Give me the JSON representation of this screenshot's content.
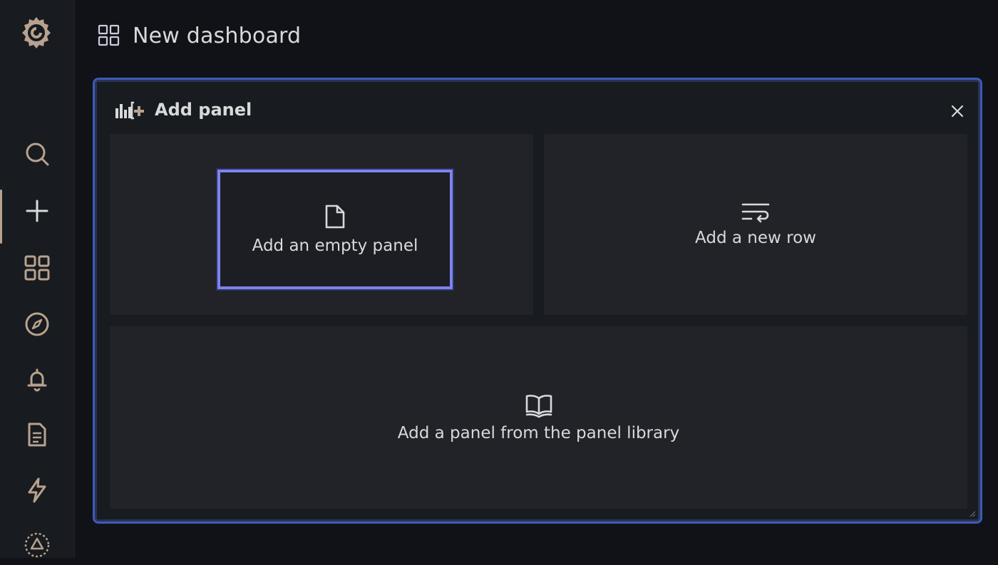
{
  "header": {
    "title": "New dashboard",
    "icon": "dashboard-grid-icon"
  },
  "sidebar": {
    "logo": "grafana-logo",
    "items": [
      {
        "name": "search",
        "icon": "search-icon"
      },
      {
        "name": "create",
        "icon": "plus-icon",
        "active": true
      },
      {
        "name": "dashboards",
        "icon": "apps-grid-icon"
      },
      {
        "name": "explore",
        "icon": "compass-icon"
      },
      {
        "name": "alerting",
        "icon": "bell-icon"
      },
      {
        "name": "reports",
        "icon": "document-icon"
      },
      {
        "name": "plugins",
        "icon": "lightning-icon"
      },
      {
        "name": "profile",
        "icon": "avatar-icon"
      }
    ]
  },
  "panel": {
    "title": "Add panel",
    "icon": "add-panel-icon",
    "close_icon": "close-icon",
    "options": [
      {
        "label": "Add an empty panel",
        "icon": "file-icon",
        "focused": true
      },
      {
        "label": "Add a new row",
        "icon": "wrap-text-icon"
      },
      {
        "label": "Add a panel from the panel library",
        "icon": "book-open-icon"
      }
    ]
  },
  "colors": {
    "background": "#111217",
    "sidebar": "#181b1f",
    "panel_border": "#3d5ab8",
    "focus_border": "#7b84ec",
    "option_bg": "#222328",
    "text": "#d8d9da",
    "accent": "#b8a28f"
  }
}
